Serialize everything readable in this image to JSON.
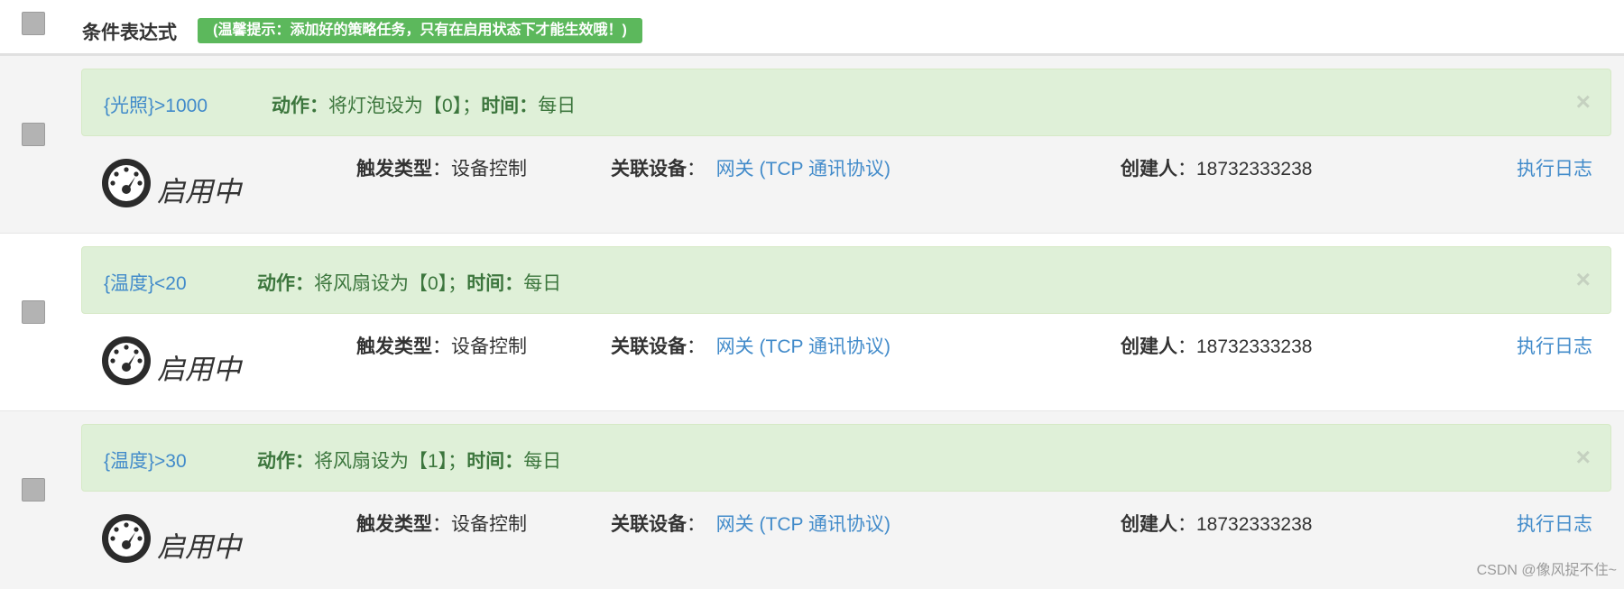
{
  "header": {
    "title": "条件表达式",
    "tip": "(温馨提示：添加好的策略任务，只有在启用状态下才能生效哦！)"
  },
  "labels": {
    "action": "动作：",
    "time": "时间：",
    "trigger_type": "触发类型",
    "device": "关联设备",
    "creator": "创建人",
    "colon": "：",
    "log": "执行日志",
    "close": "×"
  },
  "rules": [
    {
      "condition": "{光照}>1000",
      "action": "将灯泡设为【0】；",
      "time": "每日",
      "status": "启用中",
      "trigger_type": "设备控制",
      "device": "网关 (TCP 通讯协议)",
      "creator": "18732333238"
    },
    {
      "condition": "{温度}<20",
      "action": "将风扇设为【0】；",
      "time": "每日",
      "status": "启用中",
      "trigger_type": "设备控制",
      "device": "网关 (TCP 通讯协议)",
      "creator": "18732333238"
    },
    {
      "condition": "{温度}>30",
      "action": "将风扇设为【1】；",
      "time": "每日",
      "status": "启用中",
      "trigger_type": "设备控制",
      "device": "网关 (TCP 通讯协议)",
      "creator": "18732333238"
    }
  ],
  "watermark": "CSDN @像风捉不住~",
  "colors": {
    "alert_bg": "#dff0d8",
    "alert_text": "#3c763d",
    "link": "#428bca",
    "tip_bg": "#5cb85c"
  }
}
